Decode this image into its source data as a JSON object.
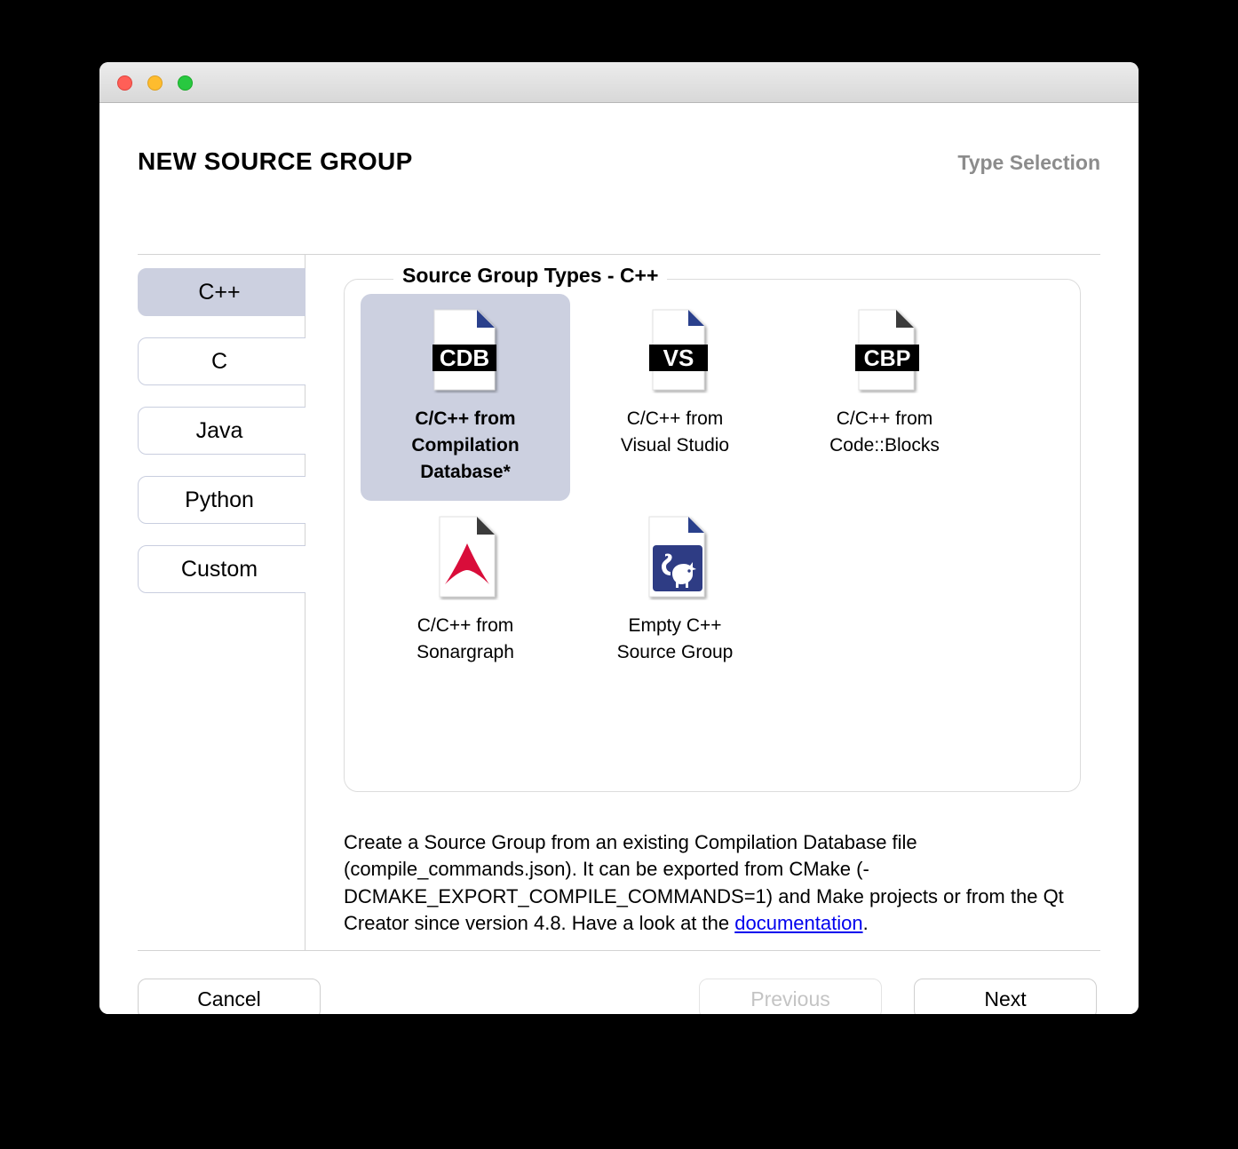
{
  "window": {
    "traffic_lights": [
      "close",
      "minimize",
      "zoom"
    ]
  },
  "header": {
    "title": "NEW SOURCE GROUP",
    "step_label": "Type Selection"
  },
  "sidebar": {
    "items": [
      {
        "label": "C++",
        "selected": true
      },
      {
        "label": "C",
        "selected": false
      },
      {
        "label": "Java",
        "selected": false
      },
      {
        "label": "Python",
        "selected": false
      },
      {
        "label": "Custom",
        "selected": false
      }
    ]
  },
  "groupbox": {
    "legend": "Source Group Types - C++",
    "tiles": [
      {
        "caption": "C/C++ from\nCompilation\nDatabase*",
        "icon": "cdb-file-icon",
        "selected": true
      },
      {
        "caption": "C/C++ from\nVisual Studio",
        "icon": "vs-file-icon",
        "selected": false
      },
      {
        "caption": "C/C++ from\nCode::Blocks",
        "icon": "cbp-file-icon",
        "selected": false
      },
      {
        "caption": "C/C++ from\nSonargraph",
        "icon": "sonargraph-file-icon",
        "selected": false
      },
      {
        "caption": "Empty C++\nSource Group",
        "icon": "sourcetrail-file-icon",
        "selected": false
      }
    ]
  },
  "description": {
    "text_before_link": "Create a Source Group from an existing Compilation Database file (compile_commands.json). It can be exported from CMake (-DCMAKE_EXPORT_COMPILE_COMMANDS=1) and Make projects or from the Qt Creator since version 4.8. Have a look at the ",
    "link_text": "documentation",
    "text_after_link": "."
  },
  "footer": {
    "cancel_label": "Cancel",
    "previous_label": "Previous",
    "next_label": "Next"
  },
  "colors": {
    "selection": "#ccd0e0",
    "link": "#0000ee",
    "disabled_text": "#c4c4c4",
    "step_label": "#8c8c8c",
    "fold_blue": "#2b3f8c",
    "fold_dark": "#3a3a3a",
    "sonargraph_red": "#d90d3a",
    "sourcetrail_blue": "#2e3c84"
  }
}
